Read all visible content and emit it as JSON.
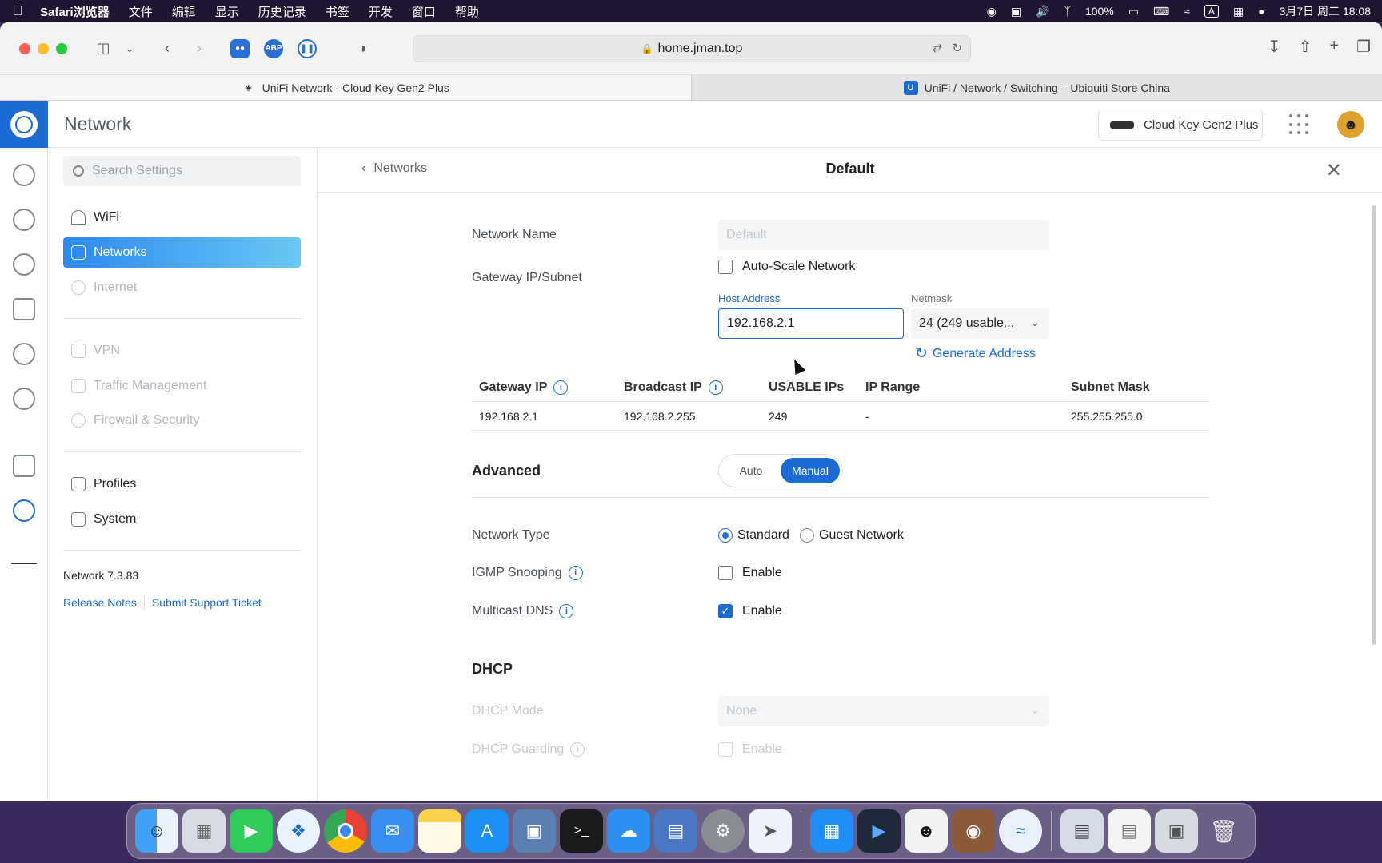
{
  "menubar": {
    "app_name": "Safari浏览器",
    "items": [
      "文件",
      "编辑",
      "显示",
      "历史记录",
      "书签",
      "开发",
      "窗口",
      "帮助"
    ],
    "battery": "100%",
    "input_method": "A",
    "datetime": "3月7日 周二  18:08"
  },
  "browser": {
    "url": "home.jman.top",
    "extensions": {
      "abp": "ABP"
    },
    "tabs": [
      {
        "label": "UniFi Network - Cloud Key Gen2 Plus"
      },
      {
        "label": "UniFi / Network / Switching – Ubiquiti Store China",
        "favicon": "U"
      }
    ]
  },
  "header": {
    "title": "Network",
    "device": "Cloud Key Gen2 Plus"
  },
  "sidebar": {
    "search_placeholder": "Search Settings",
    "items": [
      {
        "label": "WiFi"
      },
      {
        "label": "Networks"
      },
      {
        "label": "Internet"
      },
      {
        "label": "VPN"
      },
      {
        "label": "Traffic Management"
      },
      {
        "label": "Firewall & Security"
      },
      {
        "label": "Profiles"
      },
      {
        "label": "System"
      }
    ],
    "version": "Network 7.3.83",
    "release_notes": "Release Notes",
    "support_ticket": "Submit Support Ticket"
  },
  "panel": {
    "back_label": "Networks",
    "title": "Default",
    "network_name": {
      "label": "Network Name",
      "value": "Default"
    },
    "gateway": {
      "label": "Gateway IP/Subnet",
      "auto_scale": "Auto-Scale Network",
      "host_label": "Host Address",
      "host_value": "192.168.2.1",
      "netmask_label": "Netmask",
      "netmask_value": "24 (249 usable..."
    },
    "generate": "Generate Address",
    "table": {
      "headers": [
        "Gateway IP",
        "Broadcast IP",
        "USABLE IPs",
        "IP Range",
        "Subnet Mask"
      ],
      "row": [
        "192.168.2.1",
        "192.168.2.255",
        "249",
        "-",
        "255.255.255.0"
      ]
    },
    "advanced": {
      "title": "Advanced",
      "auto": "Auto",
      "manual": "Manual"
    },
    "network_type": {
      "label": "Network Type",
      "standard": "Standard",
      "guest": "Guest Network"
    },
    "igmp": {
      "label": "IGMP Snooping",
      "option": "Enable"
    },
    "mdns": {
      "label": "Multicast DNS",
      "option": "Enable"
    },
    "dhcp": {
      "title": "DHCP",
      "mode_label": "DHCP Mode",
      "mode_value": "None",
      "guarding_label": "DHCP Guarding",
      "guarding_option": "Enable"
    }
  },
  "colors": {
    "accent": "#1c6bd5",
    "active_gradient_start": "#2a8af0",
    "active_gradient_end": "#6ac8f5"
  }
}
